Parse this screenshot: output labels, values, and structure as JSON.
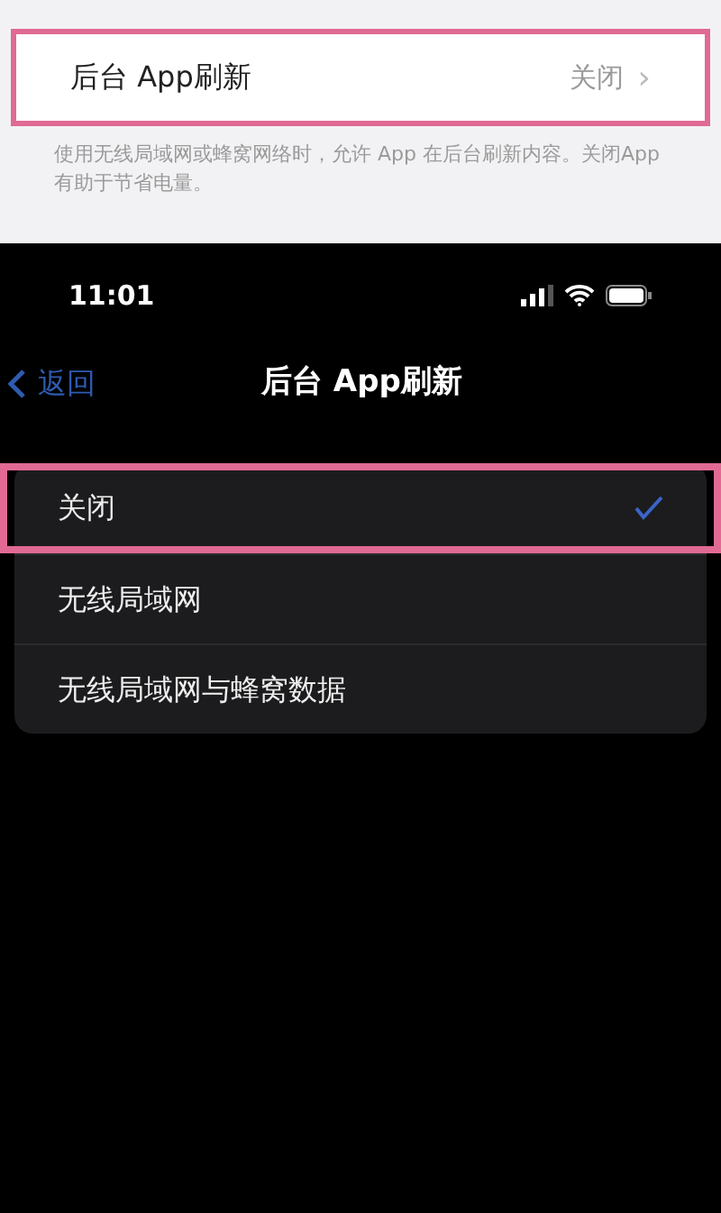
{
  "settings_row": {
    "label": "后台 App刷新",
    "value": "关闭",
    "chevron": "›",
    "highlighted": true
  },
  "footnote": "使用无线局域网或蜂窝网络时，允许 App 在后台刷新内容。关闭App 有助于节省电量。",
  "status_bar": {
    "time": "11:01"
  },
  "nav": {
    "back": "返回",
    "title": "后台 App刷新"
  },
  "options": [
    {
      "label": "关闭",
      "selected": true,
      "highlighted": true
    },
    {
      "label": "无线局域网",
      "selected": false,
      "highlighted": false
    },
    {
      "label": "无线局域网与蜂窝数据",
      "selected": false,
      "highlighted": false
    }
  ]
}
